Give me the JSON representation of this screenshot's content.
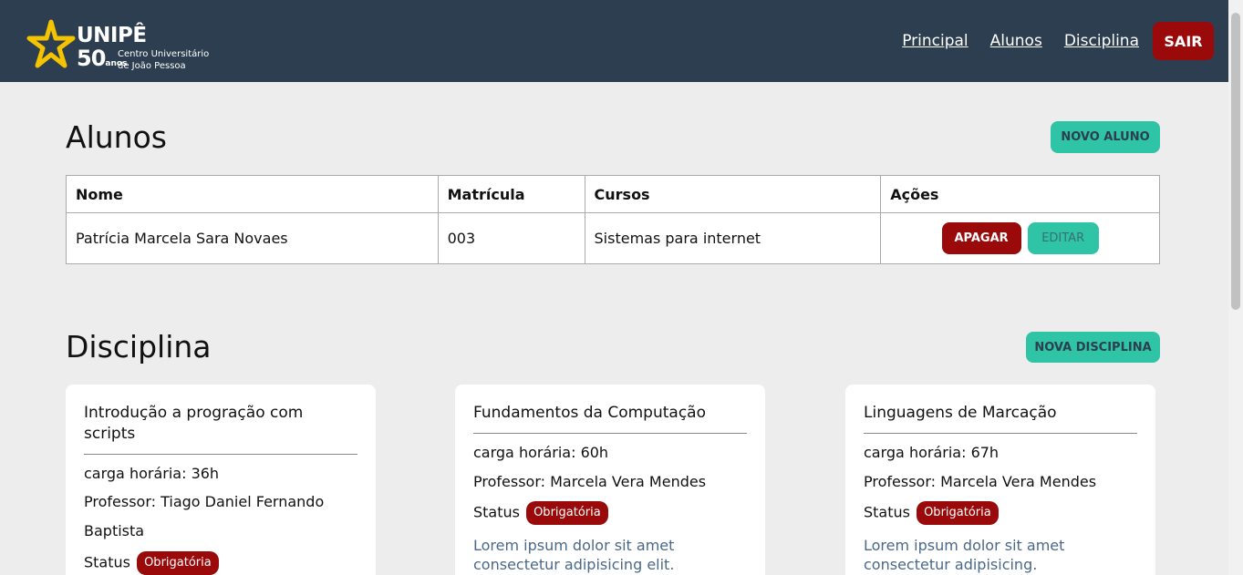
{
  "brand": {
    "name": "UNIPÊ",
    "years": "50",
    "years_suffix": "anos",
    "subtitle_line1": "Centro Universitário",
    "subtitle_line2": "de João Pessoa",
    "star_color": "#f5c400"
  },
  "nav": {
    "items": [
      {
        "label": "Principal"
      },
      {
        "label": "Alunos"
      },
      {
        "label": "Disciplina"
      }
    ],
    "logout_label": "SAIR"
  },
  "alunos": {
    "title": "Alunos",
    "new_button": "NOVO ALUNO",
    "columns": [
      "Nome",
      "Matrícula",
      "Cursos",
      "Ações"
    ],
    "rows": [
      {
        "nome": "Patrícia Marcela Sara Novaes",
        "matricula": "003",
        "curso": "Sistemas para internet",
        "delete_label": "APAGAR",
        "edit_label": "EDITAR"
      }
    ]
  },
  "disciplina": {
    "title": "Disciplina",
    "new_button": "NOVA DISCIPLINA",
    "cards": [
      {
        "title": "Introdução a progração com scripts",
        "carga": "carga horária: 36h",
        "professor": "Professor: Tiago Daniel Fernando Baptista",
        "status_label": "Status",
        "status_badge": "Obrigatória",
        "description": ""
      },
      {
        "title": "Fundamentos da Computação",
        "carga": "carga horária: 60h",
        "professor": "Professor: Marcela Vera Mendes",
        "status_label": "Status",
        "status_badge": "Obrigatória",
        "description": "Lorem ipsum dolor sit amet consectetur adipisicing elit."
      },
      {
        "title": "Linguagens de Marcação",
        "carga": "carga horária: 67h",
        "professor": "Professor: Marcela Vera Mendes",
        "status_label": "Status",
        "status_badge": "Obrigatória",
        "description": "Lorem ipsum dolor sit amet consectetur adipisicing."
      }
    ]
  },
  "colors": {
    "header_bg": "#2c3e50",
    "page_bg": "#ededed",
    "danger": "#9b0a0a",
    "accent": "#2ec4a5"
  }
}
